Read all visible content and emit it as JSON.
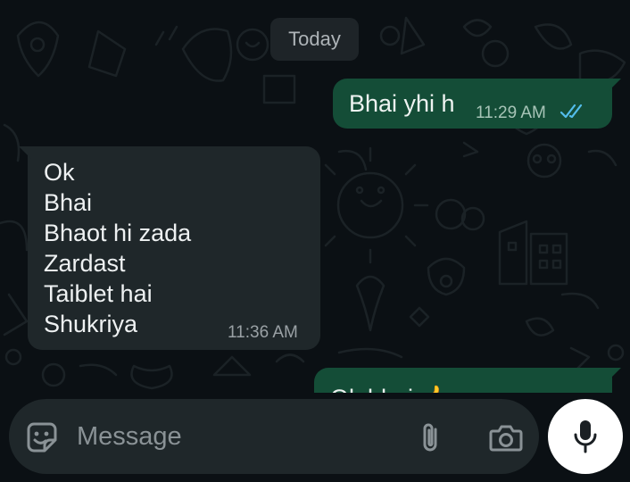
{
  "chat": {
    "date_label": "Today",
    "messages": [
      {
        "direction": "outgoing",
        "text": "Bhai yhi h",
        "time": "11:29 AM",
        "status": "read-double-tick"
      },
      {
        "direction": "incoming",
        "lines": [
          "Ok",
          "Bhai",
          "Bhaot hi zada",
          "Zardast",
          "Taiblet hai",
          "Shukriya"
        ],
        "time": "11:36 AM"
      },
      {
        "direction": "outgoing",
        "text": "Ok bhai 👍",
        "partially_visible": true
      }
    ]
  },
  "composer": {
    "placeholder": "Message",
    "emoji_icon": "sticker-icon",
    "attach_icon": "paperclip-icon",
    "camera_icon": "camera-icon"
  },
  "mic": {
    "icon": "microphone-icon"
  },
  "colors": {
    "background": "#0b1014",
    "outgoing_bubble": "#144d37",
    "incoming_bubble": "#1f272a",
    "read_tick": "#53bdeb",
    "composer": "#1f272a",
    "mic_button": "#ffffff"
  }
}
